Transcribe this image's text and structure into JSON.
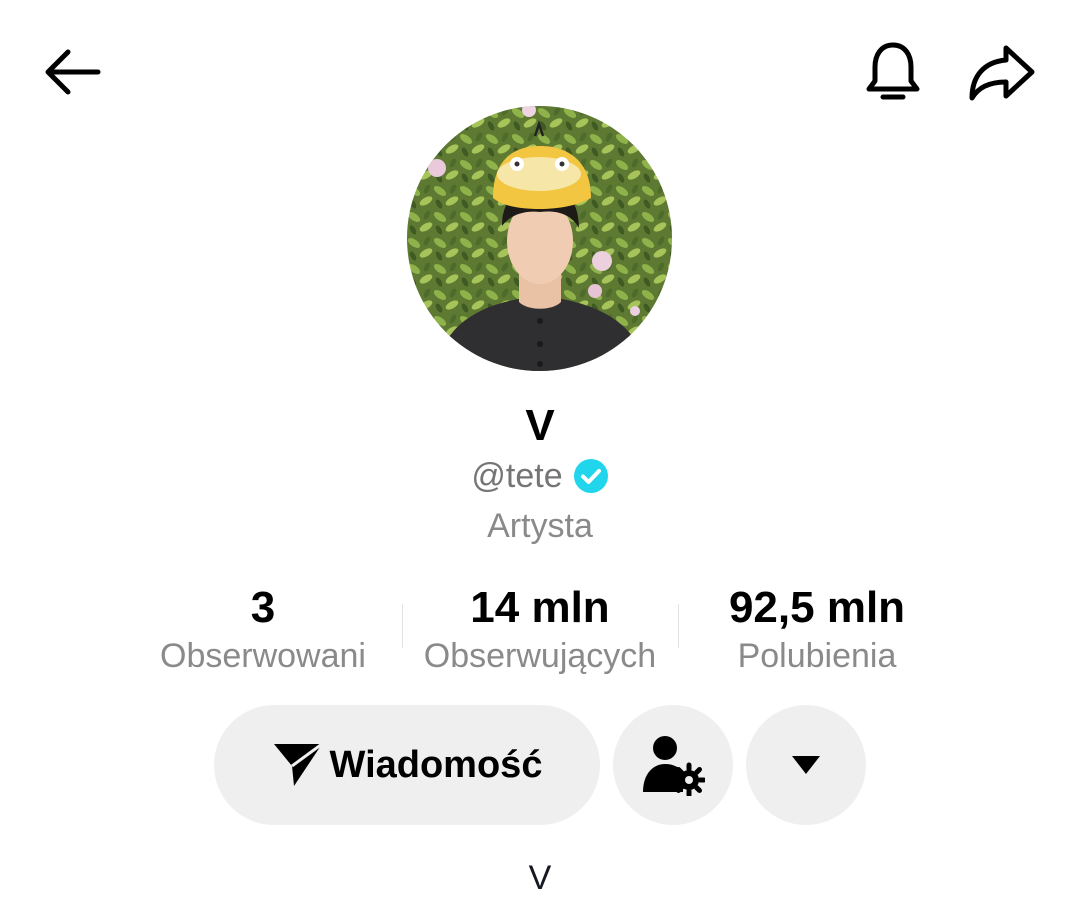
{
  "header": {
    "back_icon": "arrow-left-icon",
    "notification_icon": "bell-icon",
    "share_icon": "share-arrow-icon"
  },
  "profile": {
    "display_name": "V",
    "handle": "@tete",
    "verified": true,
    "category": "Artysta",
    "bio": "V"
  },
  "stats": [
    {
      "value": "3",
      "label": "Obserwowani"
    },
    {
      "value": "14 mln",
      "label": "Obserwujących"
    },
    {
      "value": "92,5 mln",
      "label": "Polubienia"
    }
  ],
  "actions": {
    "message_label": "Wiadomość",
    "message_icon": "send-icon",
    "friends_icon": "user-settings-icon",
    "more_icon": "triangle-down-icon"
  },
  "colors": {
    "verified_badge": "#20d5ec",
    "button_bg": "#efefef",
    "secondary_text": "#8a8a8a"
  }
}
